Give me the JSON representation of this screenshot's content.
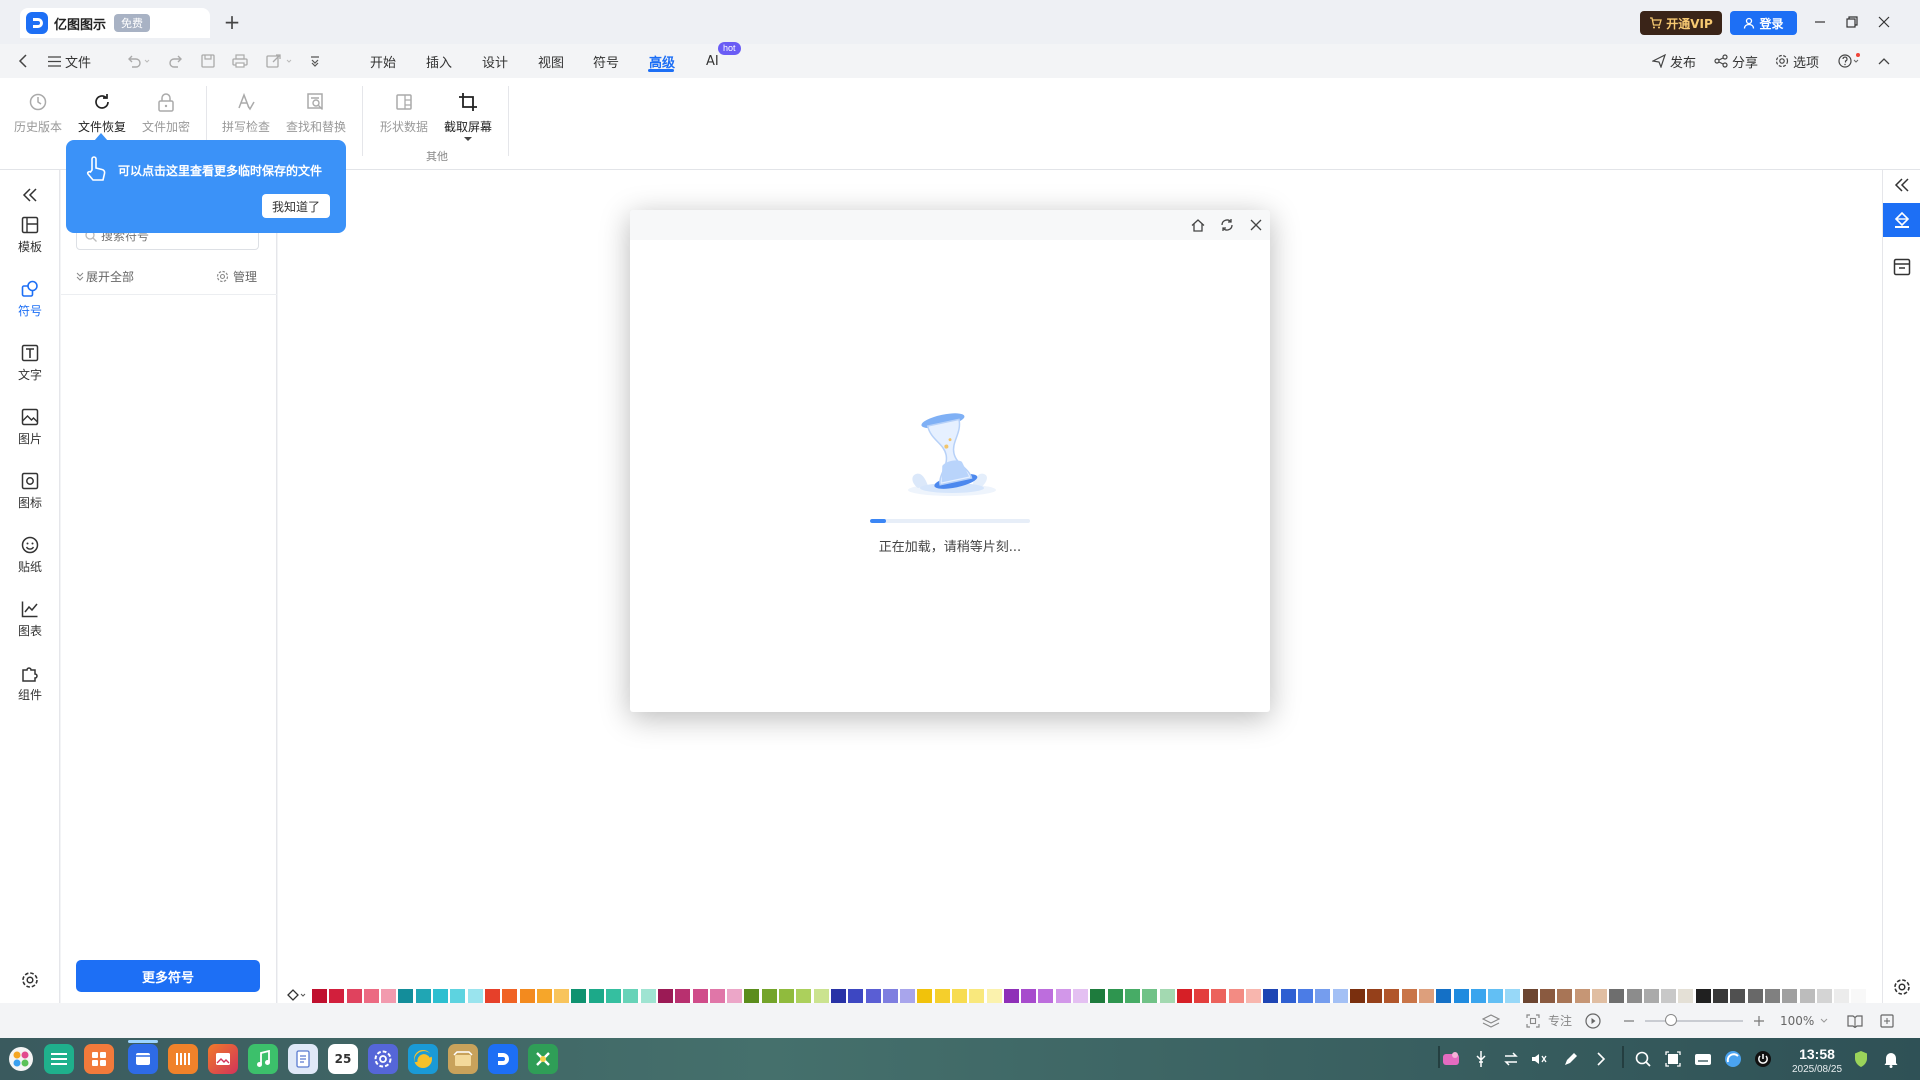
{
  "window": {
    "app_name": "亿图图示",
    "badge": "免费",
    "new_tab": "+",
    "vip_label": "开通VIP",
    "login_label": "登录"
  },
  "menubar": {
    "file_label": "文件",
    "tabs": [
      "开始",
      "插入",
      "设计",
      "视图",
      "符号",
      "高级",
      "AI"
    ],
    "active_tab": "高级",
    "ai_badge": "hot",
    "publish": "发布",
    "share": "分享",
    "options": "选项"
  },
  "ribbon": {
    "buttons": [
      {
        "label": "历史版本",
        "icon": "history-icon"
      },
      {
        "label": "文件恢复",
        "icon": "refresh-icon"
      },
      {
        "label": "文件加密",
        "icon": "lock-icon"
      },
      {
        "label": "拼写检查",
        "icon": "spell-check-icon"
      },
      {
        "label": "查找和替换",
        "icon": "find-replace-icon"
      },
      {
        "label": "形状数据",
        "icon": "shape-data-icon"
      },
      {
        "label": "截取屏幕",
        "icon": "crop-icon"
      }
    ],
    "group_label": "其他"
  },
  "tooltip": {
    "text": "可以点击这里查看更多临时保存的文件",
    "ok_label": "我知道了"
  },
  "left_bar": {
    "items": [
      {
        "label": "模板",
        "icon": "template-icon"
      },
      {
        "label": "符号",
        "icon": "symbol-icon"
      },
      {
        "label": "文字",
        "icon": "text-icon"
      },
      {
        "label": "图片",
        "icon": "image-icon"
      },
      {
        "label": "图标",
        "icon": "icon-library-icon"
      },
      {
        "label": "贴纸",
        "icon": "sticker-icon"
      },
      {
        "label": "图表",
        "icon": "chart-icon"
      },
      {
        "label": "组件",
        "icon": "component-icon"
      }
    ],
    "selected": "符号"
  },
  "panel": {
    "search_placeholder": "搜索符号",
    "expand_all": "展开全部",
    "manage": "管理",
    "more_button": "更多符号"
  },
  "dialog": {
    "loading_text": "正在加载，请稍等片刻...",
    "progress": 0.1
  },
  "status": {
    "focus_label": "专注",
    "zoom": "100%"
  },
  "taskbar": {
    "calendar_day": "25",
    "time": "13:58",
    "date": "2025/08/25"
  },
  "colors": {
    "accent": "#1d6ff5",
    "palette": [
      "#c0102e",
      "#d21f3c",
      "#e0425e",
      "#ec6a82",
      "#f29aae",
      "#138d9a",
      "#20a6b4",
      "#2cbfd0",
      "#5dd3e0",
      "#9ae4ee",
      "#e6402a",
      "#f06325",
      "#f38a1e",
      "#f6a62a",
      "#f8c45c",
      "#0f9270",
      "#1ca989",
      "#35bfa0",
      "#67d3b8",
      "#9fe4d2",
      "#9b1a55",
      "#b8306f",
      "#d04c8a",
      "#e076a8",
      "#eca6c8",
      "#5b8d1c",
      "#74a42a",
      "#90bb3d",
      "#acd05c",
      "#cbe38f",
      "#2832a6",
      "#3d47c2",
      "#5a5ed4",
      "#7e7ee0",
      "#a8a5ec",
      "#f1c20b",
      "#f5cf2c",
      "#f7dc51",
      "#f9e87c",
      "#fbf2ad",
      "#8f2fb8",
      "#a74bcd",
      "#bd6ddd",
      "#d297e9",
      "#e4c0f2",
      "#1e7b3d",
      "#2e954f",
      "#47ac66",
      "#70c287",
      "#a3d9b1",
      "#d61f26",
      "#e33e3d",
      "#ec625c",
      "#f38b83",
      "#f8b6ae",
      "#1e45b4",
      "#2e5fd2",
      "#4b7ce6",
      "#759dee",
      "#a3c0f5",
      "#7a2f0e",
      "#95401a",
      "#b1562b",
      "#c97548",
      "#dd9f7c",
      "#1470c6",
      "#1f8bdf",
      "#3aa5ee",
      "#62bff4",
      "#97d8f8",
      "#6c4530",
      "#8a5a40",
      "#a87556",
      "#c69675",
      "#e0bea2",
      "#6e6e6e",
      "#8c8c8c",
      "#aaaaaa",
      "#c8c8c8",
      "#e4e0d6",
      "#202020",
      "#383838",
      "#505050",
      "#686868",
      "#808080",
      "#a0a0a0",
      "#bcbcbc",
      "#d4d4d4",
      "#ececec",
      "#f8f8f8"
    ]
  }
}
